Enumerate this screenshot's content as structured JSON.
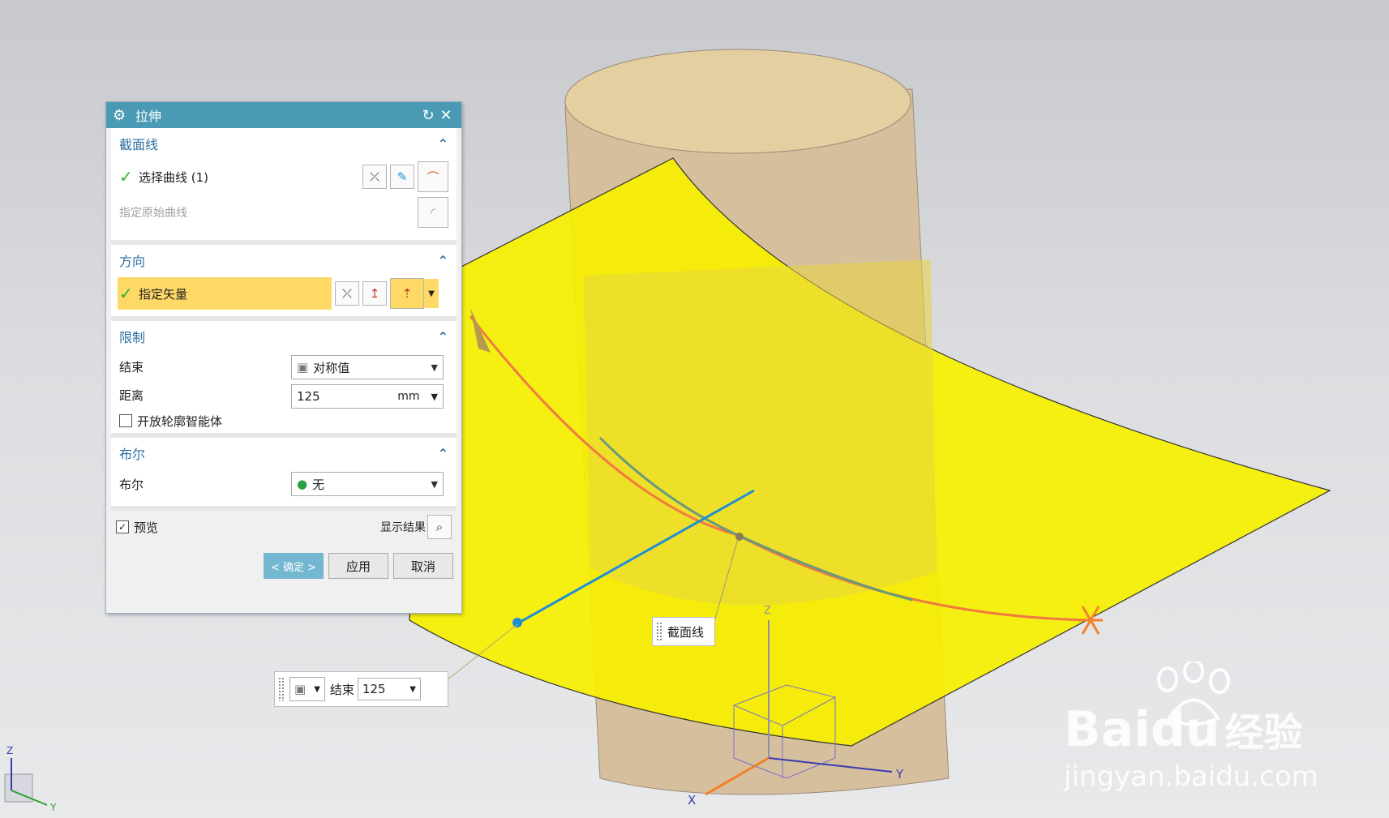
{
  "dialog": {
    "title": "拉伸",
    "section_curve": {
      "header": "截面线",
      "select_curve": "选择曲线 (1)",
      "specify_origin": "指定原始曲线"
    },
    "section_direction": {
      "header": "方向",
      "specify_vector": "指定矢量"
    },
    "section_limits": {
      "header": "限制",
      "end_label": "结束",
      "end_value": "对称值",
      "distance_label": "距离",
      "distance_value": "125",
      "distance_unit": "mm",
      "open_profile": "开放轮廓智能体"
    },
    "section_boolean": {
      "header": "布尔",
      "boolean_label": "布尔",
      "boolean_value": "无"
    },
    "preview": "预览",
    "show_result": "显示结果",
    "ok": "< 确定 >",
    "apply": "应用",
    "cancel": "取消"
  },
  "viewport": {
    "section_tag": "截面线",
    "onscreen_end_label": "结束",
    "onscreen_end_value": "125",
    "axis_x": "X",
    "axis_y": "Y",
    "axis_z": "Z"
  },
  "watermark": {
    "brand": "Bai",
    "brand_du": "du",
    "brand_cn": "经验",
    "url": "jingyan.baidu.com"
  },
  "colors": {
    "title_bar": "#4b9ab5",
    "highlight": "#ffd966",
    "sheet": "#f5ef00",
    "cylinder": "#d9bf99"
  }
}
